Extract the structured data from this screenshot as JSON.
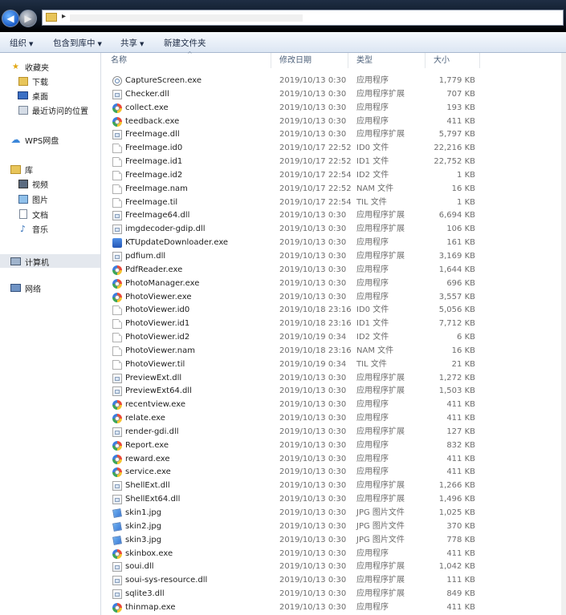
{
  "navigation": {
    "back_symbol": "◀",
    "forward_symbol": "▶",
    "breadcrumb_arrow": "▸"
  },
  "toolbar": {
    "items": [
      {
        "label": "组织",
        "has_dropdown": true
      },
      {
        "label": "包含到库中",
        "has_dropdown": true
      },
      {
        "label": "共享",
        "has_dropdown": true
      },
      {
        "label": "新建文件夹",
        "has_dropdown": false
      }
    ],
    "dropdown_glyph": "▼"
  },
  "sidebar": {
    "items": [
      {
        "label": "收藏夹",
        "icon": "star-icon",
        "level": 0
      },
      {
        "label": "下载",
        "icon": "download-folder-icon",
        "level": 1
      },
      {
        "label": "桌面",
        "icon": "desktop-icon",
        "level": 1
      },
      {
        "label": "最近访问的位置",
        "icon": "recent-places-icon",
        "level": 1
      },
      {
        "label": "WPS网盘",
        "icon": "cloud-icon",
        "level": 0
      },
      {
        "label": "库",
        "icon": "library-icon",
        "level": 0
      },
      {
        "label": "视频",
        "icon": "video-icon",
        "level": 1
      },
      {
        "label": "图片",
        "icon": "picture-icon",
        "level": 1
      },
      {
        "label": "文档",
        "icon": "document-icon",
        "level": 1
      },
      {
        "label": "音乐",
        "icon": "music-icon",
        "level": 1
      },
      {
        "label": "计算机",
        "icon": "computer-icon",
        "level": 0
      },
      {
        "label": "网络",
        "icon": "network-icon",
        "level": 0
      }
    ]
  },
  "columns": {
    "name": "名称",
    "date": "修改日期",
    "type": "类型",
    "size": "大小",
    "sort_glyph": "^"
  },
  "files": [
    {
      "name": "CaptureScreen.exe",
      "date": "2019/10/13 0:30",
      "type": "应用程序",
      "size": "1,779 KB",
      "icon": "capture"
    },
    {
      "name": "Checker.dll",
      "date": "2019/10/13 0:30",
      "type": "应用程序扩展",
      "size": "707 KB",
      "icon": "dll"
    },
    {
      "name": "collect.exe",
      "date": "2019/10/13 0:30",
      "type": "应用程序",
      "size": "193 KB",
      "icon": "exe"
    },
    {
      "name": "teedback.exe",
      "date": "2019/10/13 0:30",
      "type": "应用程序",
      "size": "411 KB",
      "icon": "exe"
    },
    {
      "name": "FreeImage.dll",
      "date": "2019/10/13 0:30",
      "type": "应用程序扩展",
      "size": "5,797 KB",
      "icon": "dll"
    },
    {
      "name": "FreeImage.id0",
      "date": "2019/10/17 22:52",
      "type": "ID0 文件",
      "size": "22,216 KB",
      "icon": "file"
    },
    {
      "name": "FreeImage.id1",
      "date": "2019/10/17 22:52",
      "type": "ID1 文件",
      "size": "22,752 KB",
      "icon": "file"
    },
    {
      "name": "FreeImage.id2",
      "date": "2019/10/17 22:54",
      "type": "ID2 文件",
      "size": "1 KB",
      "icon": "file"
    },
    {
      "name": "FreeImage.nam",
      "date": "2019/10/17 22:52",
      "type": "NAM 文件",
      "size": "16 KB",
      "icon": "file"
    },
    {
      "name": "FreeImage.til",
      "date": "2019/10/17 22:54",
      "type": "TIL 文件",
      "size": "1 KB",
      "icon": "file"
    },
    {
      "name": "FreeImage64.dll",
      "date": "2019/10/13 0:30",
      "type": "应用程序扩展",
      "size": "6,694 KB",
      "icon": "dll"
    },
    {
      "name": "imgdecoder-gdip.dll",
      "date": "2019/10/13 0:30",
      "type": "应用程序扩展",
      "size": "106 KB",
      "icon": "dll"
    },
    {
      "name": "KTUpdateDownloader.exe",
      "date": "2019/10/13 0:30",
      "type": "应用程序",
      "size": "161 KB",
      "icon": "kt"
    },
    {
      "name": "pdfium.dll",
      "date": "2019/10/13 0:30",
      "type": "应用程序扩展",
      "size": "3,169 KB",
      "icon": "dll"
    },
    {
      "name": "PdfReader.exe",
      "date": "2019/10/13 0:30",
      "type": "应用程序",
      "size": "1,644 KB",
      "icon": "exe"
    },
    {
      "name": "PhotoManager.exe",
      "date": "2019/10/13 0:30",
      "type": "应用程序",
      "size": "696 KB",
      "icon": "exe"
    },
    {
      "name": "PhotoViewer.exe",
      "date": "2019/10/13 0:30",
      "type": "应用程序",
      "size": "3,557 KB",
      "icon": "exe"
    },
    {
      "name": "PhotoViewer.id0",
      "date": "2019/10/18 23:16",
      "type": "ID0 文件",
      "size": "5,056 KB",
      "icon": "file"
    },
    {
      "name": "PhotoViewer.id1",
      "date": "2019/10/18 23:16",
      "type": "ID1 文件",
      "size": "7,712 KB",
      "icon": "file"
    },
    {
      "name": "PhotoViewer.id2",
      "date": "2019/10/19 0:34",
      "type": "ID2 文件",
      "size": "6 KB",
      "icon": "file"
    },
    {
      "name": "PhotoViewer.nam",
      "date": "2019/10/18 23:16",
      "type": "NAM 文件",
      "size": "16 KB",
      "icon": "file"
    },
    {
      "name": "PhotoViewer.til",
      "date": "2019/10/19 0:34",
      "type": "TIL 文件",
      "size": "21 KB",
      "icon": "file"
    },
    {
      "name": "PreviewExt.dll",
      "date": "2019/10/13 0:30",
      "type": "应用程序扩展",
      "size": "1,272 KB",
      "icon": "dll"
    },
    {
      "name": "PreviewExt64.dll",
      "date": "2019/10/13 0:30",
      "type": "应用程序扩展",
      "size": "1,503 KB",
      "icon": "dll"
    },
    {
      "name": "recentview.exe",
      "date": "2019/10/13 0:30",
      "type": "应用程序",
      "size": "411 KB",
      "icon": "exe"
    },
    {
      "name": "relate.exe",
      "date": "2019/10/13 0:30",
      "type": "应用程序",
      "size": "411 KB",
      "icon": "exe"
    },
    {
      "name": "render-gdi.dll",
      "date": "2019/10/13 0:30",
      "type": "应用程序扩展",
      "size": "127 KB",
      "icon": "dll"
    },
    {
      "name": "Report.exe",
      "date": "2019/10/13 0:30",
      "type": "应用程序",
      "size": "832 KB",
      "icon": "exe"
    },
    {
      "name": "reward.exe",
      "date": "2019/10/13 0:30",
      "type": "应用程序",
      "size": "411 KB",
      "icon": "exe"
    },
    {
      "name": "service.exe",
      "date": "2019/10/13 0:30",
      "type": "应用程序",
      "size": "411 KB",
      "icon": "exe"
    },
    {
      "name": "ShellExt.dll",
      "date": "2019/10/13 0:30",
      "type": "应用程序扩展",
      "size": "1,266 KB",
      "icon": "dll"
    },
    {
      "name": "ShellExt64.dll",
      "date": "2019/10/13 0:30",
      "type": "应用程序扩展",
      "size": "1,496 KB",
      "icon": "dll"
    },
    {
      "name": "skin1.jpg",
      "date": "2019/10/13 0:30",
      "type": "JPG 图片文件",
      "size": "1,025 KB",
      "icon": "jpg"
    },
    {
      "name": "skin2.jpg",
      "date": "2019/10/13 0:30",
      "type": "JPG 图片文件",
      "size": "370 KB",
      "icon": "jpg"
    },
    {
      "name": "skin3.jpg",
      "date": "2019/10/13 0:30",
      "type": "JPG 图片文件",
      "size": "778 KB",
      "icon": "jpg"
    },
    {
      "name": "skinbox.exe",
      "date": "2019/10/13 0:30",
      "type": "应用程序",
      "size": "411 KB",
      "icon": "exe"
    },
    {
      "name": "soui.dll",
      "date": "2019/10/13 0:30",
      "type": "应用程序扩展",
      "size": "1,042 KB",
      "icon": "dll"
    },
    {
      "name": "soui-sys-resource.dll",
      "date": "2019/10/13 0:30",
      "type": "应用程序扩展",
      "size": "111 KB",
      "icon": "dll"
    },
    {
      "name": "sqlite3.dll",
      "date": "2019/10/13 0:30",
      "type": "应用程序扩展",
      "size": "849 KB",
      "icon": "dll"
    },
    {
      "name": "thinmap.exe",
      "date": "2019/10/13 0:30",
      "type": "应用程序",
      "size": "411 KB",
      "icon": "exe"
    }
  ]
}
